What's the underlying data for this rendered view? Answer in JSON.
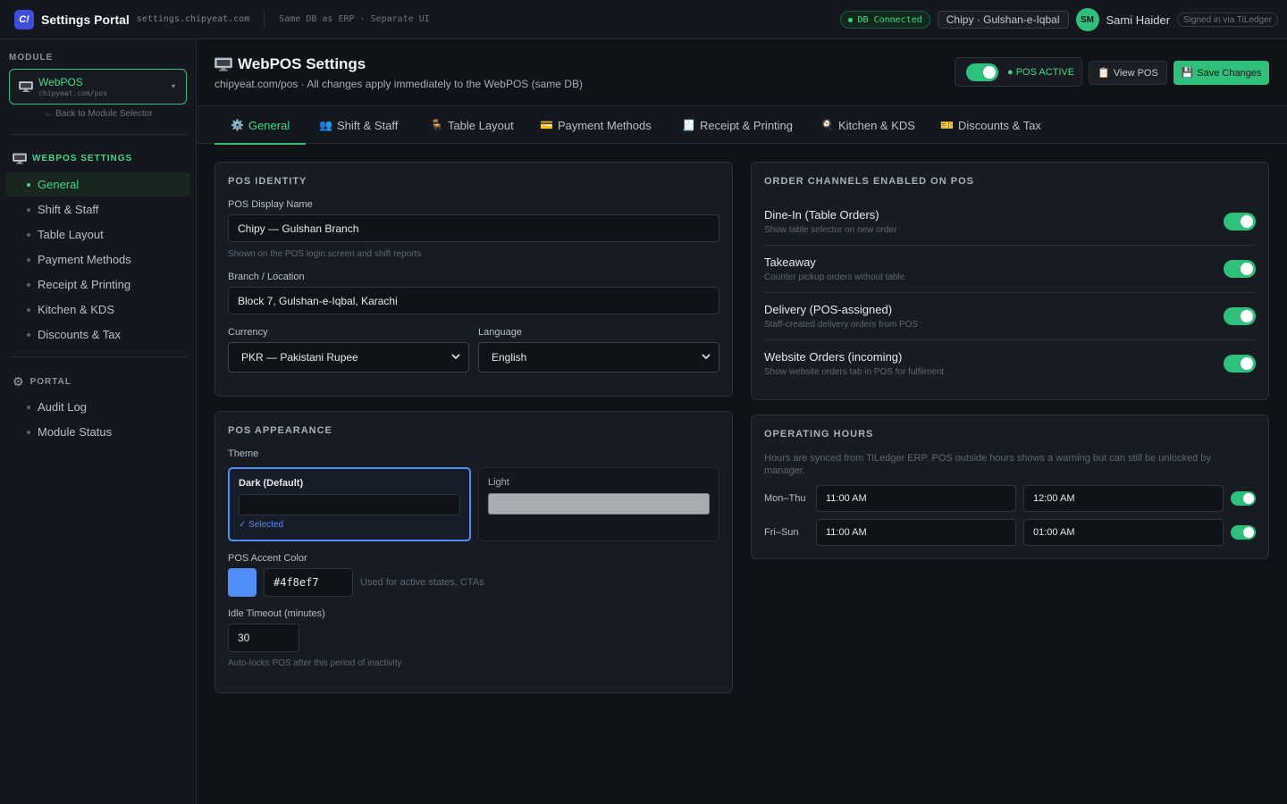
{
  "topbar": {
    "logo_text": "C!",
    "app_title": "Settings Portal",
    "app_domain": "settings.chipyeat.com",
    "note": "Same DB as ERP · Separate UI",
    "db_status": "DB Connected",
    "branch": "Chipy · Gulshan-e-Iqbal",
    "avatar_initials": "SM",
    "user_name": "Sami Haider",
    "signed_in": "Signed in via TiLedger"
  },
  "sidebar": {
    "module_label": "MODULE",
    "module_name": "WebPOS",
    "module_url": "chipyeat.com/pos",
    "back_link": "← Back to Module Selector",
    "section_webpos": "WEBPOS SETTINGS",
    "webpos_items": [
      {
        "label": "General"
      },
      {
        "label": "Shift & Staff"
      },
      {
        "label": "Table Layout"
      },
      {
        "label": "Payment Methods"
      },
      {
        "label": "Receipt & Printing"
      },
      {
        "label": "Kitchen & KDS"
      },
      {
        "label": "Discounts & Tax"
      }
    ],
    "section_portal": "PORTAL",
    "portal_items": [
      {
        "label": "Audit Log"
      },
      {
        "label": "Module Status"
      }
    ]
  },
  "header": {
    "title": "WebPOS Settings",
    "subtitle": "chipyeat.com/pos · All changes apply immediately to the WebPOS (same DB)",
    "pos_active": "● POS ACTIVE",
    "view_pos": "View POS",
    "save": "Save Changes"
  },
  "tabs": [
    {
      "label": "General",
      "icon": "⚙️"
    },
    {
      "label": "Shift & Staff",
      "icon": "👥"
    },
    {
      "label": "Table Layout",
      "icon": "🪑"
    },
    {
      "label": "Payment Methods",
      "icon": "💳"
    },
    {
      "label": "Receipt & Printing",
      "icon": "🧾"
    },
    {
      "label": "Kitchen & KDS",
      "icon": "🍳"
    },
    {
      "label": "Discounts & Tax",
      "icon": "🎫"
    }
  ],
  "identity": {
    "title": "POS IDENTITY",
    "display_name_label": "POS Display Name",
    "display_name_value": "Chipy — Gulshan Branch",
    "display_name_hint": "Shown on the POS login screen and shift reports",
    "branch_label": "Branch / Location",
    "branch_value": "Block 7, Gulshan-e-Iqbal, Karachi",
    "currency_label": "Currency",
    "currency_value": "PKR — Pakistani Rupee",
    "language_label": "Language",
    "language_value": "English"
  },
  "appearance": {
    "title": "POS APPEARANCE",
    "theme_label": "Theme",
    "theme_dark": "Dark (Default)",
    "theme_selected": "✓ Selected",
    "theme_light": "Light",
    "accent_label": "POS Accent Color",
    "accent_value": "#4f8ef7",
    "accent_hint": "Used for active states, CTAs",
    "idle_label": "Idle Timeout (minutes)",
    "idle_value": "30",
    "idle_hint": "Auto-locks POS after this period of inactivity"
  },
  "channels": {
    "title": "ORDER CHANNELS ENABLED ON POS",
    "items": [
      {
        "name": "Dine-In (Table Orders)",
        "desc": "Show table selector on new order",
        "enabled": true
      },
      {
        "name": "Takeaway",
        "desc": "Counter pickup orders without table",
        "enabled": true
      },
      {
        "name": "Delivery (POS-assigned)",
        "desc": "Staff-created delivery orders from POS",
        "enabled": true
      },
      {
        "name": "Website Orders (incoming)",
        "desc": "Show website orders tab in POS for fulfilment",
        "enabled": true
      }
    ]
  },
  "hours": {
    "title": "OPERATING HOURS",
    "note": "Hours are synced from TiLedger ERP. POS outside hours shows a warning but can still be unlocked by manager.",
    "rows": [
      {
        "label": "Mon–Thu",
        "open": "11:00 AM",
        "close": "12:00 AM",
        "enabled": true
      },
      {
        "label": "Fri–Sun",
        "open": "11:00 AM",
        "close": "01:00 AM",
        "enabled": true
      }
    ]
  },
  "colors": {
    "accent_green": "#2fc17b",
    "pos_accent": "#4f8ef7",
    "background": "#0f1217"
  }
}
